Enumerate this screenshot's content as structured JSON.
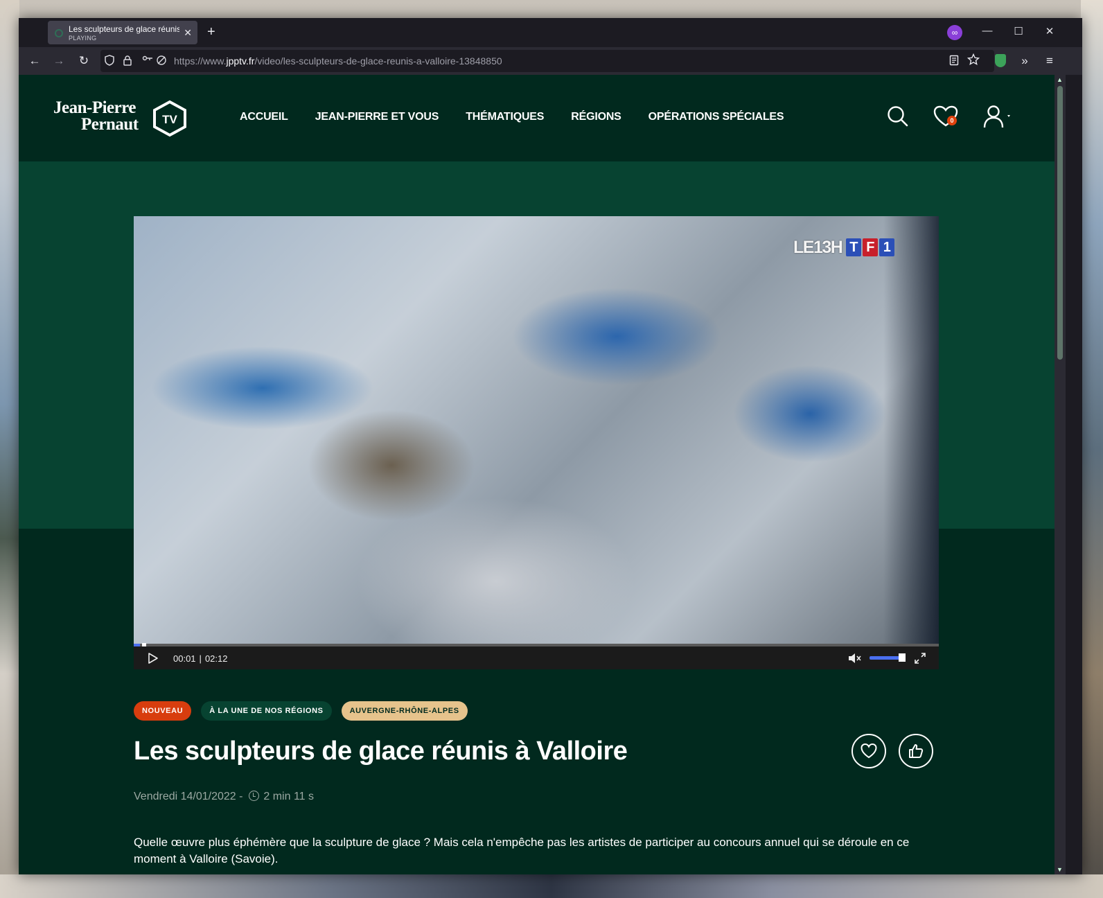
{
  "browser": {
    "tab": {
      "title": "Les sculpteurs de glace réunis à Valloire",
      "status": "PLAYING",
      "close": "✕"
    },
    "new_tab": "+",
    "window_controls": {
      "minimize": "—",
      "maximize": "☐",
      "close": "✕"
    },
    "url": {
      "scheme_prefix": "https://www.",
      "host": "jpptv.fr",
      "path": "/video/les-sculpteurs-de-glace-reunis-a-valloire-13848850"
    },
    "nav": {
      "back": "←",
      "forward": "→",
      "reload": "↻"
    },
    "toolbar_icons": [
      "reader-view-icon",
      "bookmark-star-icon",
      "shield-extension-icon",
      "overflow-chevrons-icon",
      "hamburger-menu-icon"
    ]
  },
  "site": {
    "logo": {
      "line1": "Jean-Pierre",
      "line2": "Pernaut",
      "badge": "TV"
    },
    "nav": [
      "ACCUEIL",
      "JEAN-PIERRE ET VOUS",
      "THÉMATIQUES",
      "RÉGIONS",
      "OPÉRATIONS SPÉCIALES"
    ],
    "favorites_count": "0"
  },
  "player": {
    "broadcaster": {
      "show": "LE13H",
      "channel": [
        "T",
        "F",
        "1"
      ]
    },
    "current_time": "00:01",
    "separator": "|",
    "duration": "02:12",
    "progress_fraction": 0.008,
    "volume_fraction": 0.9,
    "accent_color": "#4a6ff0"
  },
  "article": {
    "tags": [
      "NOUVEAU",
      "À LA UNE DE NOS RÉGIONS",
      "AUVERGNE-RHÔNE-ALPES"
    ],
    "title": "Les sculpteurs de glace réunis à Valloire",
    "date": "Vendredi 14/01/2022 -",
    "duration": "2 min 11 s",
    "body": "Quelle œuvre plus éphémère que la sculpture de glace ? Mais cela n'empêche pas les artistes de participer au concours annuel qui se déroule en ce moment à Valloire (Savoie)."
  },
  "colors": {
    "site_bg": "#01291e",
    "band_bg": "#074331",
    "tag_new": "#d83d0e",
    "tag_region": "#e6c38c"
  }
}
